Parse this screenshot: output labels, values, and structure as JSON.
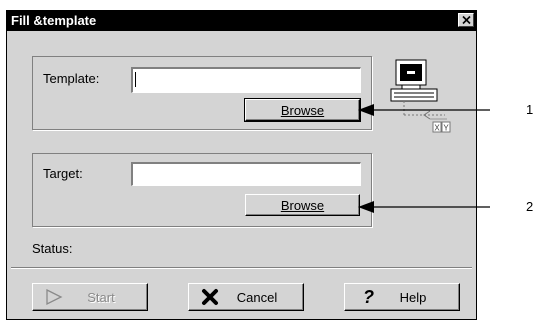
{
  "window": {
    "title": "Fill &template"
  },
  "template_group": {
    "label": "Template:",
    "value": "",
    "browse_label": "Browse"
  },
  "target_group": {
    "label": "Target:",
    "value": "",
    "browse_label": "Browse"
  },
  "status": {
    "label": "Status:"
  },
  "buttons": {
    "start": "Start",
    "cancel": "Cancel",
    "help": "Help"
  },
  "illustration": {
    "axis_x": "X",
    "axis_y": "Y"
  },
  "callouts": [
    "1",
    "2"
  ],
  "icons": {
    "close": "close-icon",
    "computer": "computer-icon",
    "play": "play-icon",
    "cancel": "x-cancel-icon",
    "help": "question-mark-icon"
  }
}
